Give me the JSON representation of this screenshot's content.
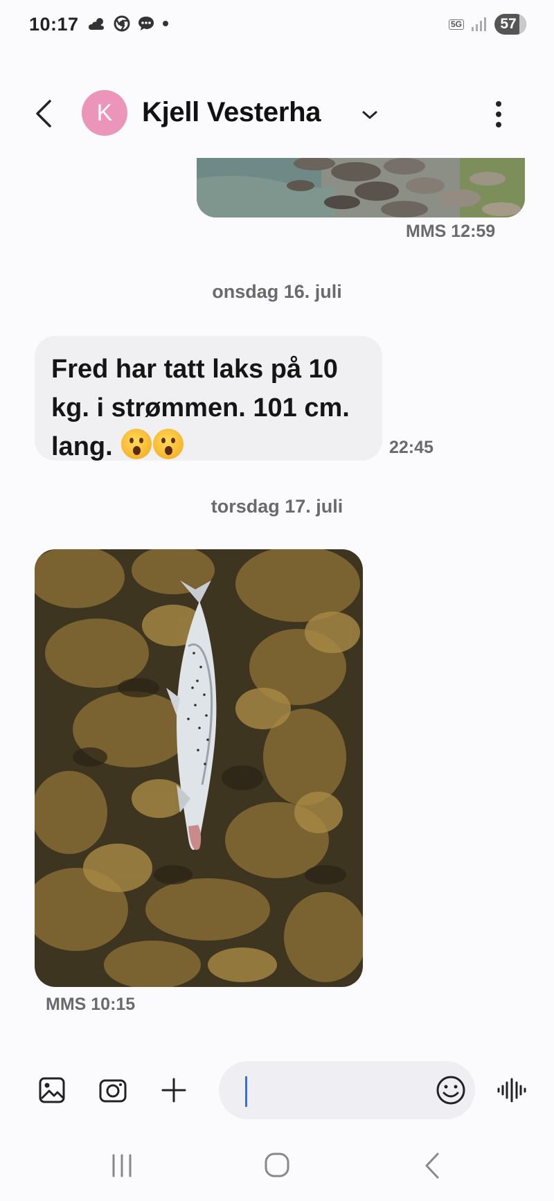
{
  "status_bar": {
    "time": "10:17",
    "network": "5G",
    "battery": "57"
  },
  "header": {
    "avatar_letter": "K",
    "contact_name": "Kjell Vesterha"
  },
  "messages": {
    "top_image_meta": "MMS 12:59",
    "date_1": "onsdag 16. juli",
    "incoming_text": "Fred har tatt laks på 10 kg. i strømmen. 101 cm. lang.",
    "incoming_time": "22:45",
    "date_2": "torsdag 17. juli",
    "image_meta": "MMS 10:15"
  },
  "composer": {
    "input_value": "",
    "input_placeholder": ""
  },
  "colors": {
    "avatar": "#ea95b9",
    "caret": "#3a6fd8",
    "bubble_in": "#f0eff2",
    "background": "#fbfafd"
  }
}
